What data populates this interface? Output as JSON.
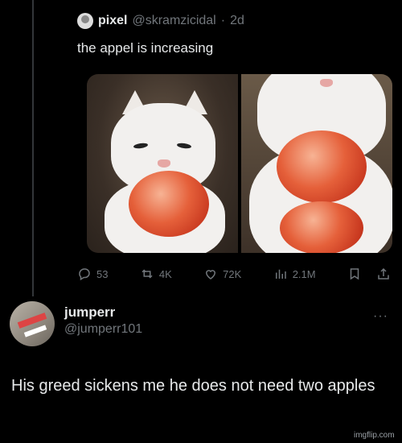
{
  "quoted_tweet": {
    "author_name": "pixel",
    "author_handle": "@skramzicidal",
    "separator": "·",
    "time": "2d",
    "text": "the appel is increasing",
    "stats": {
      "replies": "53",
      "retweets": "4K",
      "likes": "72K",
      "views": "2.1M"
    }
  },
  "reply": {
    "author_name": "jumperr",
    "author_handle": "@jumperr101",
    "more_label": "···",
    "text": "His greed sickens me he does not need two apples"
  },
  "watermark": "imgflip.com",
  "icons": {
    "reply": "comment-bubble-icon",
    "retweet": "retweet-icon",
    "like": "heart-icon",
    "views": "bar-chart-icon",
    "bookmark": "bookmark-icon",
    "share": "share-icon"
  },
  "colors": {
    "background": "#000000",
    "text": "#e7e9ea",
    "muted": "#71767b"
  }
}
